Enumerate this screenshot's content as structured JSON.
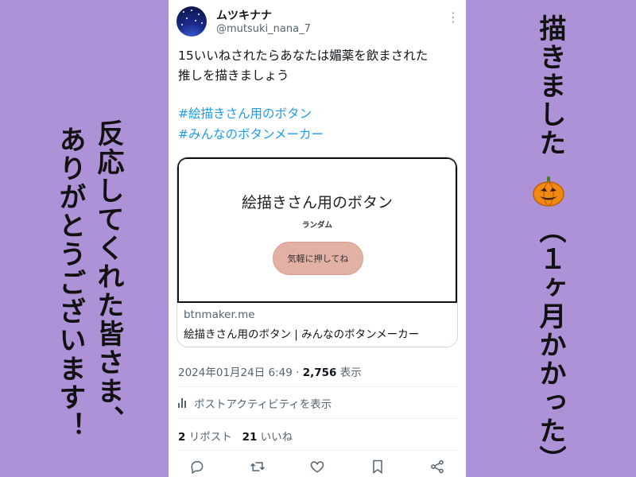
{
  "tweet": {
    "display_name": "ムツキナナ",
    "handle": "@mutsuki_nana_7",
    "more_icon": "more-dots-icon",
    "body_lines": [
      "15いいねされたらあなたは媚薬を飲まされた",
      "推しを描きましょう"
    ],
    "hashtags": [
      "#絵描きさん用のボタン",
      "#みんなのボタンメーカー"
    ],
    "link_card": {
      "preview_title": "絵描きさん用のボタン",
      "preview_subtitle": "ランダム",
      "preview_button": "気軽に押してね",
      "domain": "btnmaker.me",
      "title": "絵描きさん用のボタン | みんなのボタンメーカー"
    },
    "timestamp": "2024年01月24日 6:49 · ",
    "views_count": "2,756",
    "views_label": " 表示",
    "activity_label": "ポストアクティビティを表示",
    "reposts_count": "2",
    "reposts_label": " リポスト",
    "likes_count": "21",
    "likes_label": " いいね",
    "actions": [
      "reply-icon",
      "repost-icon",
      "like-icon",
      "bookmark-icon",
      "share-icon"
    ]
  },
  "side_text": {
    "left_line1": "ありがとうございます！",
    "left_line2": "反応してくれた皆さま、",
    "right_top": "描きました",
    "right_bottom": "（１ヶ月かかった）",
    "pumpkin_icon": "jack-o-lantern-icon"
  },
  "colors": {
    "background": "#ad92d8",
    "link": "#1d9bf0",
    "preview_button": "#e2b1a4"
  }
}
